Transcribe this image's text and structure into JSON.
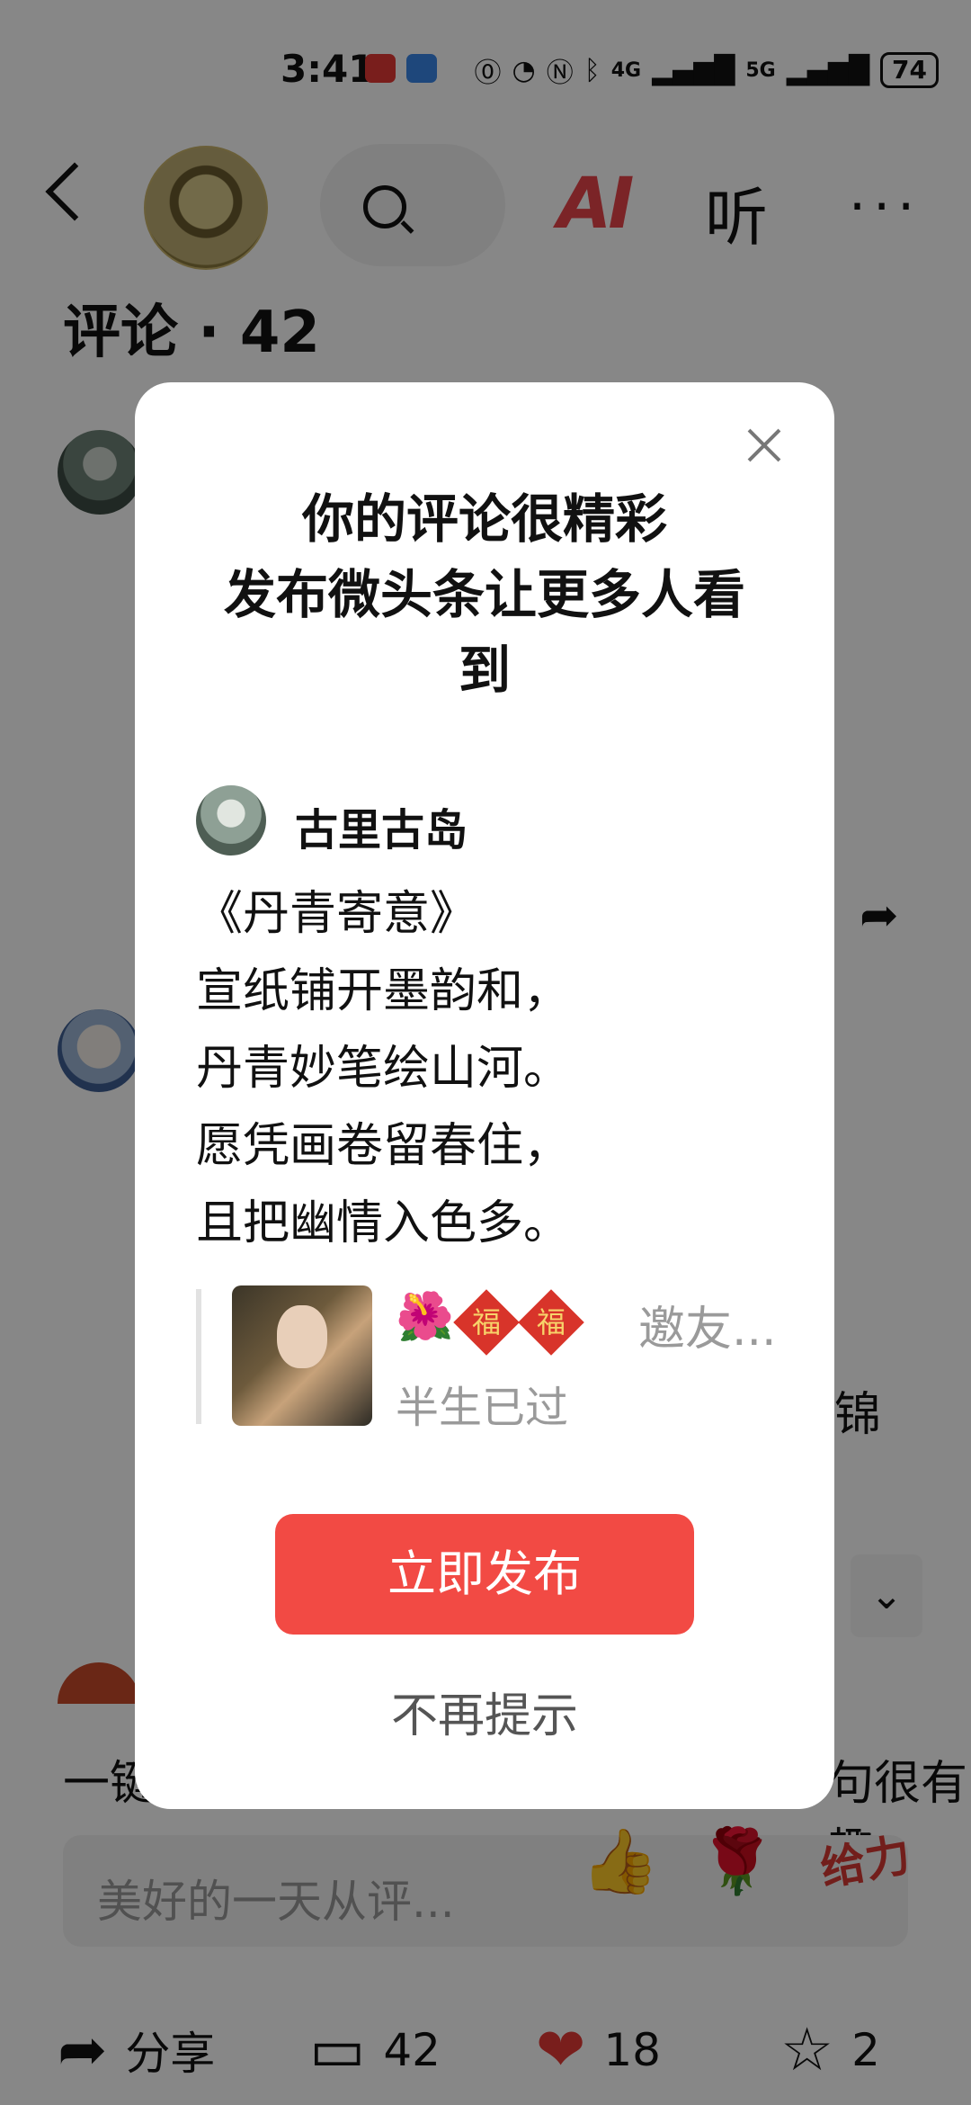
{
  "status_bar": {
    "time": "3:41",
    "signal_1": "4G",
    "signal_2": "5G",
    "battery": "74"
  },
  "nav": {
    "back_icon": "back-arrow",
    "search_icon": "search",
    "ai_label": "AI",
    "listen_label": "听",
    "more_label": "···"
  },
  "comments": {
    "title": "评论 · 42"
  },
  "background": {
    "partial_text_right": "锦",
    "partial_text_bottom_left": "一键",
    "partial_text_bottom_right": "句很有趣"
  },
  "input": {
    "placeholder": "美好的一天从评...",
    "emoji_geili": "给力"
  },
  "bottom_bar": {
    "share_label": "分享",
    "comment_count": "42",
    "like_count": "18",
    "favorite_count": "2"
  },
  "dialog": {
    "title_line1": "你的评论很精彩",
    "title_line2": "发布微头条让更多人看",
    "title_line3": "到",
    "author_name": "古里古岛",
    "poem": [
      "《丹青寄意》",
      "宣纸铺开墨韵和，",
      "丹青妙笔绘山河。",
      "愿凭画卷留春住，",
      "且把幽情入色多。"
    ],
    "quote_title": "邀友...",
    "fu_char": "福",
    "quote_subtitle": "半生已过",
    "publish_button": "立即发布",
    "no_remind": "不再提示"
  }
}
